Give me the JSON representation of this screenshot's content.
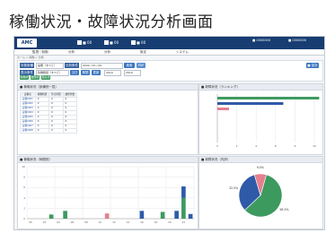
{
  "page_title": "稼働状況・故障状況分析画面",
  "app": {
    "logo_text": "AMC",
    "status_badges": [
      {
        "label": "■ 00",
        "color": "#ffffff"
      },
      {
        "label": "■ 00",
        "color": "#ffffff"
      },
      {
        "label": "■ 00",
        "color": "#ffffff"
      }
    ],
    "menu": [
      "監視・制御",
      "分析",
      "分析",
      "設定",
      "システム"
    ],
    "right_info": [
      "■ 0000000",
      "■ 0000000"
    ]
  },
  "breadcrumb": "ホーム > 稼働 > 分析",
  "filters": {
    "row1": {
      "label1": "対象設備",
      "value1": "設備（すべて）",
      "label2": "分析条件",
      "value2": "0000 / 00 / 00",
      "search_label": "検索",
      "pdf_label": "PDF"
    },
    "row2": {
      "label": "表示条件",
      "value": "稼働時間（すべて）",
      "btn_a": "当日",
      "btn_b": "期間",
      "btn_c": "更新",
      "from": "2019",
      "to": "2019"
    },
    "tags": [
      "稼働状況",
      "故障状況",
      "保全状況"
    ],
    "right_btn": "■ 保存"
  },
  "panels": {
    "table_title": "■ 稼働状況（設備別一覧）",
    "table_headers": [
      "設備名",
      "稼働時間",
      "停止時間",
      "故障件数"
    ],
    "table_rows": [
      [
        "設備0001",
        "0",
        "0",
        "0"
      ],
      [
        "設備0002",
        "0",
        "0",
        "0"
      ],
      [
        "設備0003",
        "0",
        "0",
        "0"
      ],
      [
        "設備0004",
        "0",
        "0",
        "0"
      ],
      [
        "設備0005",
        "0",
        "0",
        "0"
      ],
      [
        "設備0006",
        "0",
        "0",
        "0"
      ],
      [
        "設備0007",
        "0",
        "0",
        "0"
      ],
      [
        "設備0008",
        "0",
        "0",
        "0"
      ]
    ],
    "ranking_title": "■ 故障状況（ランキング）",
    "timeline_title": "■ 稼働状況（時間別）",
    "pie_title": "■ 故障状況（内訳）"
  },
  "chart_data": [
    {
      "type": "bar",
      "orientation": "horizontal",
      "categories": [
        "",
        "",
        ""
      ],
      "values": [
        10.5,
        6.8,
        1.2
      ],
      "colors": [
        "#3d9a5f",
        "#2e5aa8",
        "#e57f8e"
      ],
      "xlim": [
        0,
        10
      ],
      "x_ticks": [
        "0",
        "2",
        "4",
        "6",
        "8",
        "10"
      ]
    },
    {
      "type": "bar",
      "categories": [
        "0",
        "1",
        "2",
        "3",
        "4",
        "5",
        "6",
        "7",
        "8",
        "9",
        "10",
        "11",
        "12",
        "13",
        "14",
        "15",
        "16",
        "17",
        "18",
        "19",
        "20",
        "21",
        "22",
        "23"
      ],
      "series": [
        {
          "values": [
            0,
            0,
            0,
            0.8,
            0,
            1.5,
            0,
            0,
            0,
            0,
            0,
            0,
            0,
            0,
            0,
            0,
            0,
            0,
            0,
            1.3,
            0,
            0,
            9.2,
            0
          ]
        },
        {
          "values": [
            0,
            0,
            0,
            0,
            0,
            0,
            0,
            0,
            0,
            0,
            0,
            0,
            0,
            0,
            0,
            0,
            0,
            0,
            0,
            0,
            0,
            0,
            0,
            0
          ]
        },
        {
          "values": [
            0,
            0,
            0,
            0,
            0,
            0,
            0,
            0,
            0,
            0,
            0,
            0,
            0,
            0,
            0,
            0,
            0,
            0,
            0,
            0,
            0,
            0,
            0,
            0
          ]
        }
      ],
      "stacks": [
        {
          "index": 3,
          "color": "#3d9a5f",
          "value": 0.8
        },
        {
          "index": 5,
          "color": "#3d9a5f",
          "value": 1.5
        },
        {
          "index": 11,
          "color": "#e57f8e",
          "value": 1.0
        },
        {
          "index": 16,
          "color": "#2e5aa8",
          "value": 1.5
        },
        {
          "index": 19,
          "color": "#3d9a5f",
          "value": 1.3
        },
        {
          "index": 21,
          "color": "#2e5aa8",
          "value": 1.5
        },
        {
          "index": 22,
          "color": "#3d9a5f",
          "value": 4.0
        },
        {
          "index": 22,
          "color": "#2e5aa8",
          "value": 2.2
        },
        {
          "index": 23,
          "color": "#2e5aa8",
          "value": 0.9
        }
      ],
      "ylim": [
        0,
        10
      ],
      "y_ticks": [
        "0",
        "2",
        "4",
        "6",
        "8",
        "10"
      ],
      "x_ticks": [
        "00",
        "02",
        "04",
        "06",
        "08",
        "10",
        "12",
        "14",
        "16",
        "18",
        "20",
        "22"
      ]
    },
    {
      "type": "pie",
      "slices": [
        {
          "value": 58.5,
          "label": "58.5%",
          "color": "#3d9a5f"
        },
        {
          "value": 32.5,
          "label": "32.5%",
          "color": "#2e5aa8"
        },
        {
          "value": 9.0,
          "label": "9.0%",
          "color": "#e57f8e"
        }
      ]
    }
  ]
}
